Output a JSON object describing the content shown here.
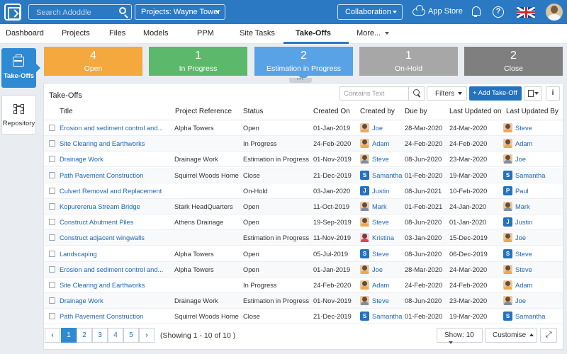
{
  "header": {
    "search_placeholder": "Search Adoddle",
    "project_select": "Projects: Wayne Tower",
    "collaboration": "Collaboration",
    "app_store": "App Store",
    "help": "?"
  },
  "nav": {
    "items": [
      "Dashboard",
      "Projects",
      "Files",
      "Models",
      "PPM",
      "Site Tasks",
      "Take-Offs",
      "More..."
    ],
    "active": "Take-Offs"
  },
  "side": {
    "takeoffs": "Take-Offs",
    "repository": "Repository"
  },
  "status_cards": [
    {
      "count": "4",
      "label": "Open",
      "color": "#f4a83d"
    },
    {
      "count": "1",
      "label": "In Progress",
      "color": "#5cb86a"
    },
    {
      "count": "2",
      "label": "Estimation in Progress",
      "color": "#5aa2e6"
    },
    {
      "count": "1",
      "label": "On-Hold",
      "color": "#a7a7a7"
    },
    {
      "count": "2",
      "label": "Close",
      "color": "#7f7f7f"
    }
  ],
  "panel": {
    "title": "Take-Offs",
    "filter_placeholder": "Contains Text",
    "filters": "Filters",
    "add": "+ Add Take-Off",
    "info": "i"
  },
  "table": {
    "columns": [
      "Title",
      "Project Reference",
      "Status",
      "Created On",
      "Created by",
      "Due by",
      "Last Updated on",
      "Last Updated By"
    ],
    "rows": [
      {
        "title": "Erosion and sediment control and...",
        "ref": "Alpha Towers",
        "status": "Open",
        "created": "01-Jan-2019",
        "by": "Joe",
        "by_av": "photo",
        "due": "28-Mar-2020",
        "updated": "24-Mar-2020",
        "upd_by": "Steve",
        "upd_av": "photo"
      },
      {
        "title": "Site Clearing and Earthworks",
        "ref": "",
        "status": "In Progress",
        "created": "24-Feb-2020",
        "by": "Adam",
        "by_av": "photo",
        "due": "24-Feb-2020",
        "updated": "24-Feb-2020",
        "upd_by": "Adam",
        "upd_av": "photo"
      },
      {
        "title": "Drainage Work",
        "ref": "Drainage Work",
        "status": "Estimation in Progress",
        "created": "01-Nov-2019",
        "by": "Steve",
        "by_av": "photo",
        "due": "08-Jun-2020",
        "updated": "23-Mar-2020",
        "upd_by": "Joe",
        "upd_av": "photo"
      },
      {
        "title": "Path Pavement Construction",
        "ref": "Squirrel Woods Home",
        "status": "Close",
        "created": "21-Dec-2019",
        "by": "Samantha",
        "by_av": "S",
        "due": "01-Feb-2020",
        "updated": "19-Mar-2020",
        "upd_by": "Samantha",
        "upd_av": "S"
      },
      {
        "title": "Culvert Removal and Replacement",
        "ref": "",
        "status": "On-Hold",
        "created": "03-Jan-2020",
        "by": "Justin",
        "by_av": "J",
        "due": "08-Jun-2021",
        "updated": "10-Feb-2020",
        "upd_by": "Paul",
        "upd_av": "P"
      },
      {
        "title": "Kopurererua Stream Bridge",
        "ref": "Stark HeadQuarters",
        "status": "Open",
        "created": "11-Oct-2019",
        "by": "Mark",
        "by_av": "photo",
        "due": "01-Feb-2021",
        "updated": "24-Jan-2020",
        "upd_by": "Mark",
        "upd_av": "photo"
      },
      {
        "title": "Construct Abutment Piles",
        "ref": "Athens Drainage",
        "status": "Open",
        "created": "19-Sep-2019",
        "by": "Steve",
        "by_av": "photo",
        "due": "08-Jun-2020",
        "updated": "01-Jan-2020",
        "upd_by": "Justin",
        "upd_av": "J"
      },
      {
        "title": "Construct adjacent wingwalls",
        "ref": "",
        "status": "Estimation in Progress",
        "created": "11-Nov-2019",
        "by": "Kristina",
        "by_av": "red",
        "due": "03-Jan-2020",
        "updated": "15-Dec-2019",
        "upd_by": "Joe",
        "upd_av": "photo"
      },
      {
        "title": "Landscaping",
        "ref": "Alpha Towers",
        "status": "Open",
        "created": "05-Jul-2019",
        "by": "Steve",
        "by_av": "S",
        "due": "08-Jun-2020",
        "updated": "06-Dec-2019",
        "upd_by": "Steve",
        "upd_av": "S"
      },
      {
        "title": "Erosion and sediment control and...",
        "ref": "Alpha Towers",
        "status": "Open",
        "created": "01-Jan-2019",
        "by": "Joe",
        "by_av": "photo",
        "due": "28-Mar-2020",
        "updated": "24-Mar-2020",
        "upd_by": "Steve",
        "upd_av": "photo"
      },
      {
        "title": "Site Clearing and Earthworks",
        "ref": "",
        "status": "In Progress",
        "created": "24-Feb-2020",
        "by": "Adam",
        "by_av": "photo",
        "due": "24-Feb-2020",
        "updated": "24-Feb-2020",
        "upd_by": "Adam",
        "upd_av": "photo"
      },
      {
        "title": "Drainage Work",
        "ref": "Drainage Work",
        "status": "Estimation in Progress",
        "created": "01-Nov-2019",
        "by": "Steve",
        "by_av": "photo",
        "due": "08-Jun-2020",
        "updated": "23-Mar-2020",
        "upd_by": "Joe",
        "upd_av": "photo"
      },
      {
        "title": "Path Pavement Construction",
        "ref": "Squirrel Woods Home",
        "status": "Close",
        "created": "21-Dec-2019",
        "by": "Samantha",
        "by_av": "S",
        "due": "01-Feb-2020",
        "updated": "19-Mar-2020",
        "upd_by": "Samantha",
        "upd_av": "S"
      }
    ]
  },
  "pagination": {
    "pages": [
      "1",
      "2",
      "3",
      "4",
      "5"
    ],
    "prev": "‹",
    "next": "›",
    "showing": "(Showing 1 - 10 of 10 )",
    "show": "Show: 10",
    "customise": "Customise",
    "expand": "⤢"
  }
}
